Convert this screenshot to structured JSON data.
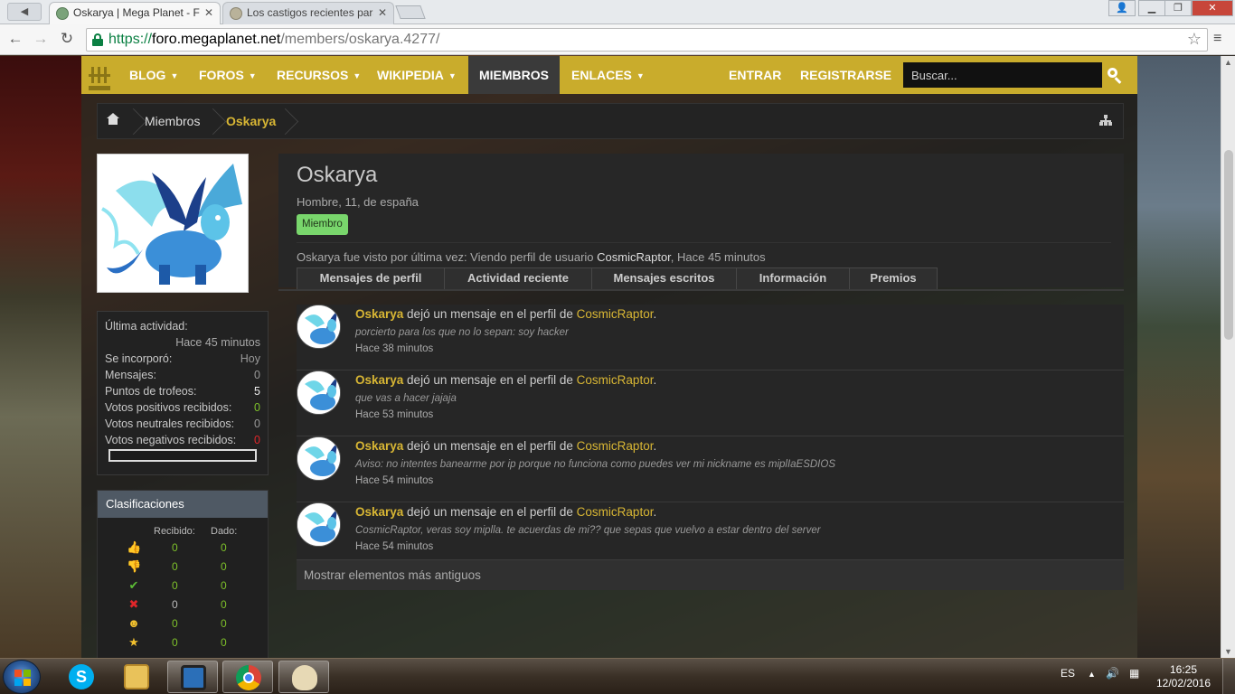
{
  "browser": {
    "tabs": [
      {
        "title": "Oskarya | Mega Planet - Fo",
        "active": true
      },
      {
        "title": "Los castigos recientes para",
        "active": false
      }
    ],
    "url_scheme": "https://",
    "url_host": "foro.megaplanet.net",
    "url_path": "/members/oskarya.4277/"
  },
  "nav": {
    "items": [
      "BLOG",
      "FOROS",
      "RECURSOS",
      "WIKIPEDIA",
      "MIEMBROS",
      "ENLACES"
    ],
    "login": "ENTRAR",
    "register": "REGISTRARSE",
    "search_placeholder": "Buscar..."
  },
  "breadcrumb": {
    "items": [
      "Miembros",
      "Oskarya"
    ]
  },
  "profile": {
    "name": "Oskarya",
    "blurb": "Hombre, 11, de españa",
    "badge": "Miembro",
    "last_seen_prefix": "Oskarya fue visto por última vez: Viendo perfil de usuario ",
    "last_seen_user": "CosmicRaptor",
    "last_seen_suffix": ", Hace 45 minutos",
    "tabs": [
      "Mensajes de perfil",
      "Actividad reciente",
      "Mensajes escritos",
      "Información",
      "Premios"
    ]
  },
  "stats": {
    "last_activity_label": "Última actividad:",
    "last_activity_value": "Hace 45 minutos",
    "rows": [
      {
        "label": "Se incorporó:",
        "value": "Hoy"
      },
      {
        "label": "Mensajes:",
        "value": "0"
      },
      {
        "label": "Puntos de trofeos:",
        "value": "5"
      },
      {
        "label": "Votos positivos recibidos:",
        "value": "0"
      },
      {
        "label": "Votos neutrales recibidos:",
        "value": "0"
      },
      {
        "label": "Votos negativos recibidos:",
        "value": "0"
      }
    ]
  },
  "ratings": {
    "title": "Clasificaciones",
    "col_received": "Recibido:",
    "col_given": "Dado:",
    "rows": [
      {
        "icon": "thumbs-up-icon",
        "received": "0",
        "given": "0"
      },
      {
        "icon": "thumbs-down-icon",
        "received": "0",
        "given": "0"
      },
      {
        "icon": "check-icon",
        "received": "0",
        "given": "0"
      },
      {
        "icon": "cross-icon",
        "received": "0",
        "given": "0"
      },
      {
        "icon": "smile-icon",
        "received": "0",
        "given": "0"
      },
      {
        "icon": "star-medal-icon",
        "received": "0",
        "given": "0"
      }
    ]
  },
  "posts": [
    {
      "author": "Oskarya",
      "action": " dejó un mensaje en el perfil de ",
      "target": "CosmicRaptor",
      "text": "porcierto para los que no lo sepan: soy hacker",
      "time": "Hace 38 minutos"
    },
    {
      "author": "Oskarya",
      "action": " dejó un mensaje en el perfil de ",
      "target": "CosmicRaptor",
      "text": "que vas a hacer jajaja",
      "time": "Hace 53 minutos"
    },
    {
      "author": "Oskarya",
      "action": " dejó un mensaje en el perfil de ",
      "target": "CosmicRaptor",
      "text": "Aviso: no intentes banearme por ip porque no funciona como puedes ver mi nickname es miplIaESDIOS",
      "time": "Hace 54 minutos"
    },
    {
      "author": "Oskarya",
      "action": " dejó un mensaje en el perfil de ",
      "target": "CosmicRaptor",
      "text": "CosmicRaptor, veras soy miplla. te acuerdas de mi?? que sepas que vuelvo a estar dentro del server",
      "time": "Hace 54 minutos"
    }
  ],
  "more_label": "Mostrar elementos más antiguos",
  "taskbar": {
    "lang": "ES",
    "time": "16:25",
    "date": "12/02/2016"
  },
  "colors": {
    "nav_bar": "#c9ac2c",
    "accent_gold": "#d8b634",
    "badge_green": "#79d66c"
  }
}
